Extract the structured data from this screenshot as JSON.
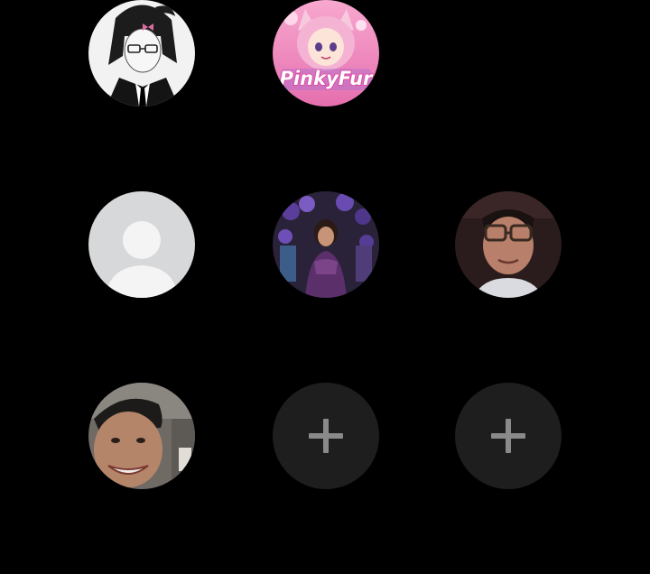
{
  "contacts_grid": {
    "rows": [
      [
        {
          "slot": "avatar-anime-character",
          "kind": "photo"
        },
        {
          "slot": "avatar-pinkyfur",
          "kind": "photo",
          "logo_text": "PinkyFur"
        },
        {
          "slot": "empty",
          "kind": "empty"
        }
      ],
      [
        {
          "slot": "avatar-default-placeholder",
          "kind": "placeholder"
        },
        {
          "slot": "avatar-girl-party",
          "kind": "photo"
        },
        {
          "slot": "avatar-man-glasses",
          "kind": "photo"
        }
      ],
      [
        {
          "slot": "avatar-boy-smiling",
          "kind": "photo"
        },
        {
          "slot": "add-slot",
          "kind": "add",
          "icon": "plus-icon"
        },
        {
          "slot": "add-slot",
          "kind": "add",
          "icon": "plus-icon"
        }
      ]
    ]
  },
  "colors": {
    "background": "#000000",
    "add_circle": "#1e1e1e",
    "plus_icon": "#8a8a8a",
    "placeholder_bg": "#d7d8da",
    "placeholder_figure": "#f4f4f5"
  }
}
